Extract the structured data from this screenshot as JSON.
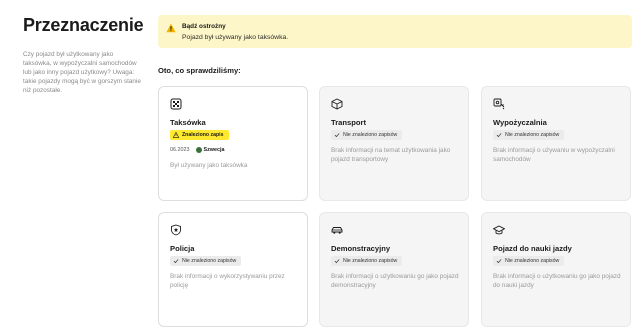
{
  "left": {
    "title": "Przeznaczenie",
    "description": "Czy pojazd był użytkowany jako taksówka, w wypożyczalni samochodów lub jako inny pojazd użytkowy? Uwaga: takie pojazdy mogą być w gorszym stanie niż pozostałe."
  },
  "warning": {
    "title": "Bądź ostrożny",
    "text": "Pojazd był używany jako taksówka.",
    "icon": "warning-triangle-icon",
    "color": "#fdf6c8"
  },
  "section_heading": "Oto, co sprawdziliśmy:",
  "cards": [
    {
      "title": "Taksówka",
      "badge": "Znaleziono zapis",
      "status": "found",
      "date": "06.2023",
      "country": "Szwecja",
      "info": "Był używany jako taksówka",
      "icon": "taxi-icon"
    },
    {
      "title": "Transport",
      "badge": "Nie znaleziono zapisów",
      "status": "none",
      "info": "Brak informacji na temat użytkowania jako pojazd transportowy",
      "icon": "box-icon"
    },
    {
      "title": "Wypożyczalnia",
      "badge": "Nie znaleziono zapisów",
      "status": "none",
      "info": "Brak informacji o używaniu w wypożyczalni samochodów",
      "icon": "rental-key-icon"
    },
    {
      "title": "Policja",
      "badge": "Nie znaleziono zapisów",
      "status": "none",
      "info": "Brak informacji o wykorzystywaniu przez policję",
      "icon": "police-shield-icon"
    },
    {
      "title": "Demonstracyjny",
      "badge": "Nie znaleziono zapisów",
      "status": "none",
      "info": "Brak informacji o użytkowaniu go jako pojazd demonstracyjny",
      "icon": "demo-car-icon"
    },
    {
      "title": "Pojazd do nauki jazdy",
      "badge": "Nie znaleziono zapisów",
      "status": "none",
      "info": "Brak informacji o użytkowaniu go jako pojazd do nauki jazdy",
      "icon": "graduation-cap-icon"
    }
  ],
  "colors": {
    "found_badge": "#ffe92e",
    "none_badge": "#ebebeb",
    "muted_card": "#f5f5f5"
  }
}
